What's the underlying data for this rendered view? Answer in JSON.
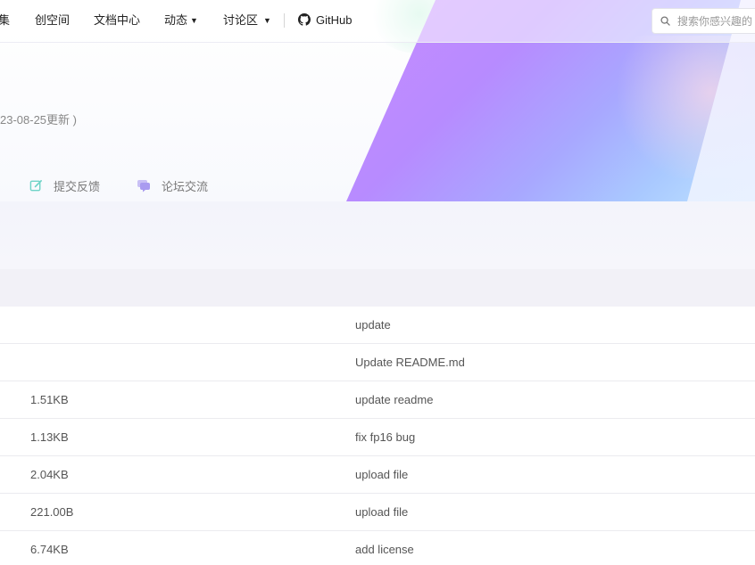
{
  "nav": {
    "items": [
      {
        "label": "集"
      },
      {
        "label": "创空间"
      },
      {
        "label": "文档中心"
      },
      {
        "label": "动态"
      },
      {
        "label": "讨论区"
      }
    ],
    "caret": "▼",
    "github_label": "GitHub",
    "search_placeholder": "搜索你感兴趣的"
  },
  "hero": {
    "update_note": "23-08-25更新 )",
    "actions": [
      {
        "label": "提交反馈",
        "icon": "edit-icon"
      },
      {
        "label": "论坛交流",
        "icon": "chat-icon"
      }
    ]
  },
  "files": [
    {
      "size": "",
      "message": "update"
    },
    {
      "size": "",
      "message": "Update README.md"
    },
    {
      "size": "1.51KB",
      "message": "update readme"
    },
    {
      "size": "1.13KB",
      "message": "fix fp16 bug"
    },
    {
      "size": "2.04KB",
      "message": "upload file"
    },
    {
      "size": "221.00B",
      "message": "upload file"
    },
    {
      "size": "6.74KB",
      "message": "add license"
    }
  ],
  "colors": {
    "accent_purple": "#b78bff",
    "icon_teal": "#6fd3c7",
    "icon_purple": "#a99bf0"
  }
}
